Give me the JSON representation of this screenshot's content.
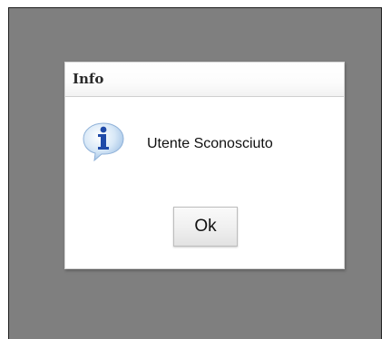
{
  "dialog": {
    "title": "Info",
    "icon": "info-icon",
    "message": "Utente Sconosciuto",
    "ok_label": "Ok"
  },
  "colors": {
    "overlay": "#7f7f7f",
    "dialog_background": "#ffffff",
    "icon_blue": "#1f4aa8",
    "icon_bubble": "#bcd6ef"
  }
}
